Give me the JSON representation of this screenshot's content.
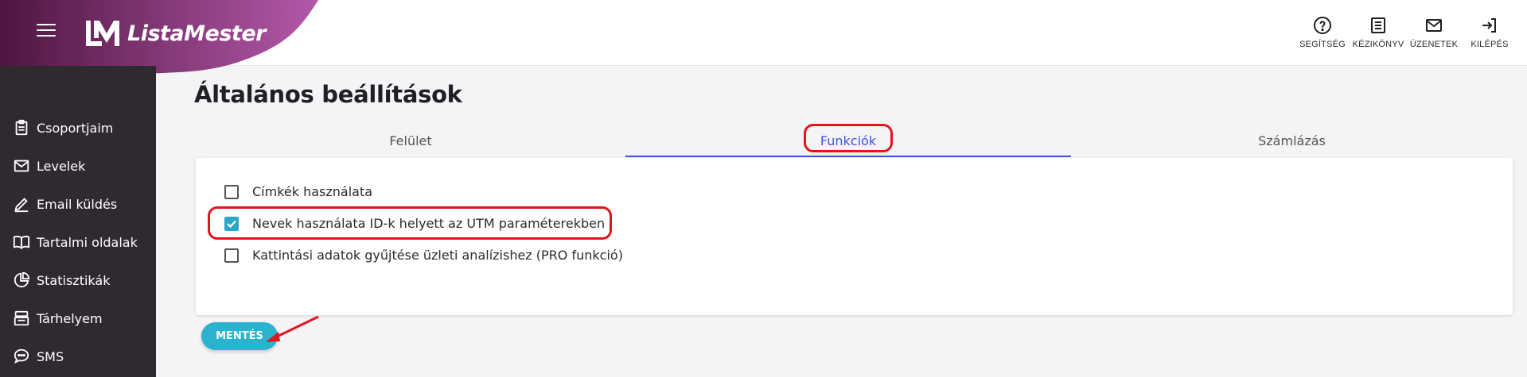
{
  "brand": {
    "name": "ListaMester",
    "gradient_start": "#5a1a4a",
    "gradient_end": "#b055a8"
  },
  "top_actions": [
    {
      "label": "SEGÍTSÉG",
      "icon": "help-circle-icon"
    },
    {
      "label": "KÉZIKÖNYV",
      "icon": "manual-list-icon"
    },
    {
      "label": "ÜZENETEK",
      "icon": "mail-icon"
    },
    {
      "label": "KILÉPÉS",
      "icon": "logout-icon"
    }
  ],
  "sidebar": {
    "items": [
      {
        "label": "Csoportjaim",
        "icon": "clipboard-icon"
      },
      {
        "label": "Levelek",
        "icon": "mail-icon"
      },
      {
        "label": "Email küldés",
        "icon": "pencil-icon"
      },
      {
        "label": "Tartalmi oldalak",
        "icon": "book-icon"
      },
      {
        "label": "Statisztikák",
        "icon": "pie-chart-icon"
      },
      {
        "label": "Tárhelyem",
        "icon": "storage-icon"
      },
      {
        "label": "SMS",
        "icon": "chat-bubble-icon"
      }
    ]
  },
  "page": {
    "title": "Általános beállítások"
  },
  "tabs": [
    {
      "label": "Felület",
      "active": false
    },
    {
      "label": "Funkciók",
      "active": true
    },
    {
      "label": "Számlázás",
      "active": false
    }
  ],
  "options": [
    {
      "label": "Címkék használata",
      "checked": false
    },
    {
      "label": "Nevek használata ID-k helyett az UTM paraméterekben",
      "checked": true
    },
    {
      "label": "Kattintási adatok gyűjtése üzleti analízishez (PRO funkció)",
      "checked": false
    }
  ],
  "save_button": {
    "label": "MENTÉS",
    "color": "#2ab3cf"
  },
  "colors": {
    "accent": "#3d55d9",
    "annotation": "#e3141c",
    "sidebar_bg": "#2f2a30"
  }
}
